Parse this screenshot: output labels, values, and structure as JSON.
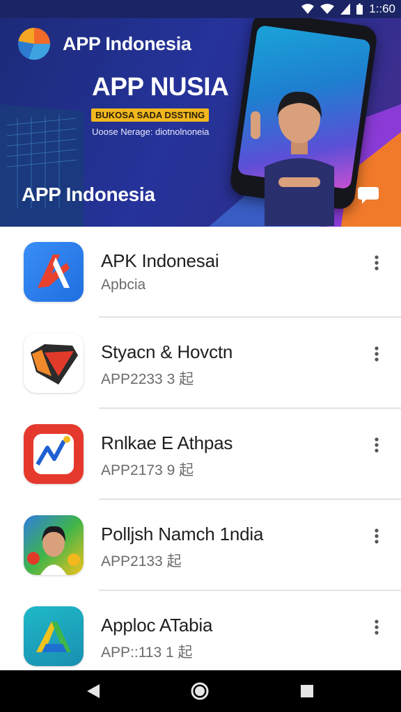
{
  "status_bar": {
    "time": "1::60"
  },
  "banner": {
    "brand_name": "APP Indonesia",
    "headline": "APP NUSIA",
    "tag": "BUKOSA SADA DSSTING",
    "subtitle": "Uoose Nerage: diotnolnoneia",
    "title": "APP Indonesia"
  },
  "apps": [
    {
      "name": "APK Indonesai",
      "subtitle": "Apbcia",
      "icon": "red-arrow-app-icon"
    },
    {
      "name": "Styacn & Hovctn",
      "subtitle": "APP2233 3 起",
      "icon": "shield-app-icon"
    },
    {
      "name": "Rnlkae E Athpas",
      "subtitle": "APP2173 9 起",
      "icon": "chart-app-icon"
    },
    {
      "name": "Polljsh Namch 1ndia",
      "subtitle": "APP2133 起",
      "icon": "portrait-app-icon"
    },
    {
      "name": "Apploc ATabia",
      "subtitle": "APP::113 1 起",
      "icon": "triangle-app-icon"
    }
  ],
  "colors": {
    "banner_primary": "#25339a",
    "accent_orange": "#f26b2a",
    "tag_yellow": "#f2b81d",
    "nav_bar": "#000000"
  }
}
